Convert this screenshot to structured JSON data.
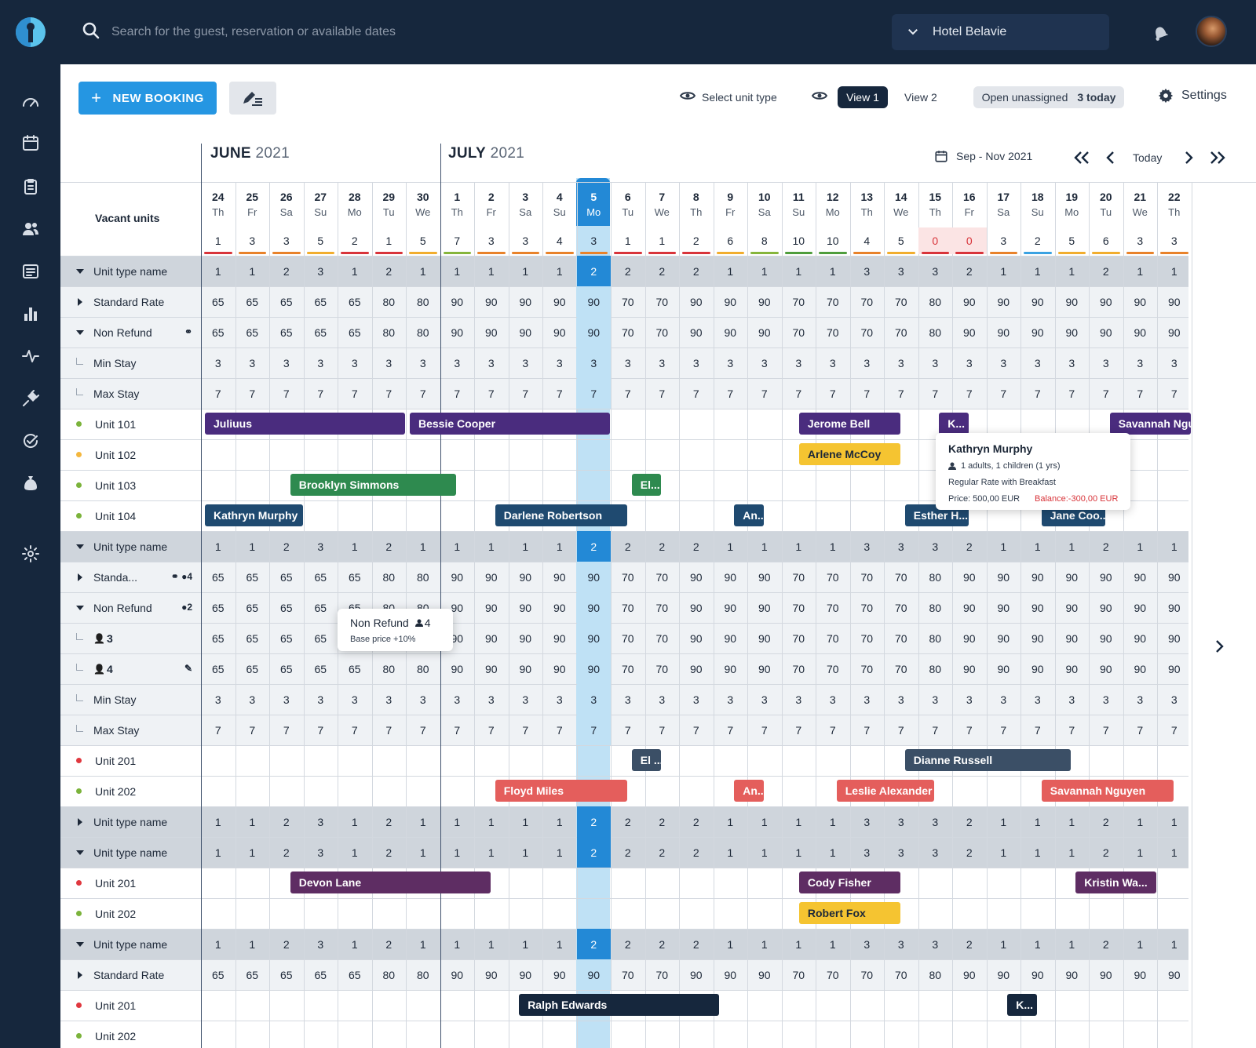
{
  "search": {
    "placeholder": "Search for the guest, reservation or available dates"
  },
  "hotel": "Hotel Belavie",
  "toolbar": {
    "new_booking": "NEW BOOKING",
    "select_unit_type": "Select unit type",
    "view1": "View 1",
    "view2": "View 2",
    "open_unassigned": "Open unassigned",
    "today_count": "3 today",
    "settings": "Settings"
  },
  "months": {
    "june_b": "JUNE",
    "june_y": "2021",
    "july_b": "JULY",
    "july_y": "2021"
  },
  "range": "Sep - Nov 2021",
  "today": "Today",
  "vacant_units": "Vacant units",
  "days": [
    [
      "24",
      "Th"
    ],
    [
      "25",
      "Fr"
    ],
    [
      "26",
      "Sa"
    ],
    [
      "27",
      "Su"
    ],
    [
      "28",
      "Mo"
    ],
    [
      "29",
      "Tu"
    ],
    [
      "30",
      "We"
    ],
    [
      "1",
      "Th"
    ],
    [
      "2",
      "Fr"
    ],
    [
      "3",
      "Sa"
    ],
    [
      "4",
      "Su"
    ],
    [
      "5",
      "Mo"
    ],
    [
      "6",
      "Tu"
    ],
    [
      "7",
      "We"
    ],
    [
      "8",
      "Th"
    ],
    [
      "9",
      "Fr"
    ],
    [
      "10",
      "Sa"
    ],
    [
      "11",
      "Su"
    ],
    [
      "12",
      "Mo"
    ],
    [
      "13",
      "Th"
    ],
    [
      "14",
      "We"
    ],
    [
      "15",
      "Th"
    ],
    [
      "16",
      "Fr"
    ],
    [
      "17",
      "Sa"
    ],
    [
      "18",
      "Su"
    ],
    [
      "19",
      "Mo"
    ],
    [
      "20",
      "Tu"
    ],
    [
      "21",
      "We"
    ],
    [
      "22",
      "Th"
    ]
  ],
  "vacant": [
    1,
    3,
    3,
    5,
    2,
    1,
    5,
    7,
    3,
    3,
    4,
    3,
    1,
    1,
    2,
    6,
    8,
    10,
    10,
    4,
    5,
    0,
    0,
    3,
    2,
    5,
    6,
    3,
    3
  ],
  "vacant_colors": [
    "#d8343a",
    "#e8822a",
    "#e8822a",
    "#f1ad2e",
    "#d8343a",
    "#d8343a",
    "#f1ad2e",
    "#86b53b",
    "#e8822a",
    "#e8822a",
    "#e8822a",
    "#e8822a",
    "#d8343a",
    "#d8343a",
    "#d8343a",
    "#f1ad2e",
    "#86b53b",
    "#4e9d3c",
    "#4e9d3c",
    "#e8822a",
    "#f1ad2e",
    "#d8343a",
    "#d8343a",
    "#e8822a",
    "#3aa2e2",
    "#f1ad2e",
    "#f1ad2e",
    "#e8822a",
    "#e8822a"
  ],
  "rows": [
    {
      "type": "grey",
      "label": "Unit type name",
      "ctl": "down",
      "vals": [
        1,
        1,
        2,
        3,
        1,
        2,
        1,
        1,
        1,
        1,
        1,
        2,
        2,
        2,
        2,
        1,
        1,
        1,
        1,
        3,
        3,
        3,
        2,
        1,
        1,
        1,
        2,
        1,
        1
      ]
    },
    {
      "type": "light",
      "label": "Standard Rate",
      "ctl": "right",
      "vals": [
        65,
        65,
        65,
        65,
        65,
        80,
        80,
        90,
        90,
        90,
        90,
        90,
        70,
        70,
        90,
        90,
        90,
        70,
        70,
        70,
        70,
        80,
        90,
        90,
        90,
        90,
        90,
        90,
        90
      ]
    },
    {
      "type": "light",
      "label": "Non Refund",
      "ctl": "down",
      "icons": "link",
      "vals": [
        65,
        65,
        65,
        65,
        65,
        80,
        80,
        90,
        90,
        90,
        90,
        90,
        70,
        70,
        90,
        90,
        90,
        70,
        70,
        70,
        70,
        80,
        90,
        90,
        90,
        90,
        90,
        90,
        90
      ]
    },
    {
      "type": "light",
      "label": "Min Stay",
      "ctl": "elbow",
      "vals": [
        3,
        3,
        3,
        3,
        3,
        3,
        3,
        3,
        3,
        3,
        3,
        3,
        3,
        3,
        3,
        3,
        3,
        3,
        3,
        3,
        3,
        3,
        3,
        3,
        3,
        3,
        3,
        3,
        3
      ]
    },
    {
      "type": "light",
      "label": "Max Stay",
      "ctl": "elbow",
      "vals": [
        7,
        7,
        7,
        7,
        7,
        7,
        7,
        7,
        7,
        7,
        7,
        7,
        7,
        7,
        7,
        7,
        7,
        7,
        7,
        7,
        7,
        7,
        7,
        7,
        7,
        7,
        7,
        7,
        7
      ]
    },
    {
      "type": "white",
      "label": "Unit 101",
      "ctl": "dot",
      "dot": "#7bb33b",
      "bookings": [
        {
          "name": "Juliuus",
          "s": 0,
          "e": 6,
          "color": "#4a2c7e"
        },
        {
          "name": "Bessie Cooper",
          "s": 6,
          "e": 12,
          "color": "#4a2c7e"
        },
        {
          "name": "Jerome Bell",
          "s": 17.4,
          "e": 20.5,
          "color": "#4a2c7e"
        },
        {
          "name": "K...",
          "s": 21.5,
          "e": 22.5,
          "color": "#4a2c7e"
        },
        {
          "name": "Savannah Ngu",
          "s": 26.5,
          "e": 29,
          "color": "#4a2c7e"
        }
      ]
    },
    {
      "type": "white",
      "label": "Unit 102",
      "ctl": "dot",
      "dot": "#f4b73e",
      "bookings": [
        {
          "name": "Arlene McCoy",
          "s": 17.4,
          "e": 20.5,
          "color": "#f5c431",
          "dark": true
        }
      ]
    },
    {
      "type": "white",
      "label": "Unit 103",
      "ctl": "dot",
      "dot": "#7bb33b",
      "bookings": [
        {
          "name": "Brooklyn Simmons",
          "s": 2.5,
          "e": 7.5,
          "color": "#2e8a4f"
        },
        {
          "name": "El...",
          "s": 12.5,
          "e": 13.5,
          "color": "#2e8a4f"
        }
      ]
    },
    {
      "type": "white",
      "label": "Unit 104",
      "ctl": "dot",
      "dot": "#7bb33b",
      "bookings": [
        {
          "name": "Kathryn Murphy",
          "s": 0,
          "e": 3,
          "color": "#1f4a70"
        },
        {
          "name": "Darlene Robertson",
          "s": 8.5,
          "e": 12.5,
          "color": "#1f4a70"
        },
        {
          "name": "An...",
          "s": 15.5,
          "e": 16.5,
          "color": "#1f4a70"
        },
        {
          "name": "Esther H...",
          "s": 20.5,
          "e": 22.5,
          "color": "#1f4a70"
        },
        {
          "name": "Jane Coo...",
          "s": 24.5,
          "e": 26.5,
          "color": "#1f4a70"
        }
      ]
    },
    {
      "type": "grey",
      "label": "Unit type name",
      "ctl": "down",
      "vals": [
        1,
        1,
        2,
        3,
        1,
        2,
        1,
        1,
        1,
        1,
        1,
        2,
        2,
        2,
        2,
        1,
        1,
        1,
        1,
        3,
        3,
        3,
        2,
        1,
        1,
        1,
        2,
        1,
        1
      ]
    },
    {
      "type": "light",
      "label": "Standa...",
      "ctl": "right",
      "icons": "link-person4",
      "vals": [
        65,
        65,
        65,
        65,
        65,
        80,
        80,
        90,
        90,
        90,
        90,
        90,
        70,
        70,
        90,
        90,
        90,
        70,
        70,
        70,
        70,
        80,
        90,
        90,
        90,
        90,
        90,
        90,
        90
      ]
    },
    {
      "type": "light",
      "label": "Non Refund",
      "ctl": "down",
      "icons": "person2",
      "vals": [
        65,
        65,
        65,
        65,
        65,
        80,
        80,
        90,
        90,
        90,
        90,
        90,
        70,
        70,
        90,
        90,
        90,
        70,
        70,
        70,
        70,
        80,
        90,
        90,
        90,
        90,
        90,
        90,
        90
      ]
    },
    {
      "type": "light",
      "label": "3",
      "ctl": "elbow-person",
      "vals": [
        65,
        65,
        65,
        65,
        65,
        80,
        80,
        90,
        90,
        90,
        90,
        90,
        70,
        70,
        90,
        90,
        90,
        70,
        70,
        70,
        70,
        80,
        90,
        90,
        90,
        90,
        90,
        90,
        90
      ]
    },
    {
      "type": "light",
      "label": "4",
      "ctl": "elbow-person",
      "icons": "pencil",
      "vals": [
        65,
        65,
        65,
        65,
        65,
        80,
        80,
        90,
        90,
        90,
        90,
        90,
        70,
        70,
        90,
        90,
        90,
        70,
        70,
        70,
        70,
        80,
        90,
        90,
        90,
        90,
        90,
        90,
        90
      ]
    },
    {
      "type": "light",
      "label": "Min Stay",
      "ctl": "elbow",
      "vals": [
        3,
        3,
        3,
        3,
        3,
        3,
        3,
        3,
        3,
        3,
        3,
        3,
        3,
        3,
        3,
        3,
        3,
        3,
        3,
        3,
        3,
        3,
        3,
        3,
        3,
        3,
        3,
        3,
        3
      ]
    },
    {
      "type": "light",
      "label": "Max Stay",
      "ctl": "elbow",
      "vals": [
        7,
        7,
        7,
        7,
        7,
        7,
        7,
        7,
        7,
        7,
        7,
        7,
        7,
        7,
        7,
        7,
        7,
        7,
        7,
        7,
        7,
        7,
        7,
        7,
        7,
        7,
        7,
        7,
        7
      ]
    },
    {
      "type": "white",
      "label": "Unit 201",
      "ctl": "dot",
      "dot": "#e0383f",
      "bookings": [
        {
          "name": "El ...",
          "s": 12.5,
          "e": 13.5,
          "color": "#3b4f66"
        },
        {
          "name": "Dianne Russell",
          "s": 20.5,
          "e": 25.5,
          "color": "#3b4f66"
        }
      ]
    },
    {
      "type": "white",
      "label": "Unit 202",
      "ctl": "dot",
      "dot": "#7bb33b",
      "bookings": [
        {
          "name": "Floyd Miles",
          "s": 8.5,
          "e": 12.5,
          "color": "#e45e5c"
        },
        {
          "name": "An...",
          "s": 15.5,
          "e": 16.5,
          "color": "#e45e5c"
        },
        {
          "name": "Leslie Alexander",
          "s": 18.5,
          "e": 21.5,
          "color": "#e45e5c"
        },
        {
          "name": "Savannah Nguyen",
          "s": 24.5,
          "e": 28.5,
          "color": "#e45e5c"
        }
      ]
    },
    {
      "type": "grey",
      "label": "Unit type name",
      "ctl": "right",
      "vals": [
        1,
        1,
        2,
        3,
        1,
        2,
        1,
        1,
        1,
        1,
        1,
        2,
        2,
        2,
        2,
        1,
        1,
        1,
        1,
        3,
        3,
        3,
        2,
        1,
        1,
        1,
        2,
        1,
        1
      ]
    },
    {
      "type": "grey",
      "label": "Unit type name",
      "ctl": "down",
      "vals": [
        1,
        1,
        2,
        3,
        1,
        2,
        1,
        1,
        1,
        1,
        1,
        2,
        2,
        2,
        2,
        1,
        1,
        1,
        1,
        3,
        3,
        3,
        2,
        1,
        1,
        1,
        2,
        1,
        1
      ]
    },
    {
      "type": "white",
      "label": "Unit 201",
      "ctl": "dot",
      "dot": "#e0383f",
      "bookings": [
        {
          "name": "Devon Lane",
          "s": 2.5,
          "e": 8.5,
          "color": "#5e2d63"
        },
        {
          "name": "Cody Fisher",
          "s": 17.4,
          "e": 20.5,
          "color": "#5e2d63"
        },
        {
          "name": "Kristin Wa...",
          "s": 25.5,
          "e": 28,
          "color": "#5e2d63"
        }
      ]
    },
    {
      "type": "white",
      "label": "Unit 202",
      "ctl": "dot",
      "dot": "#7bb33b",
      "bookings": [
        {
          "name": "Robert Fox",
          "s": 17.4,
          "e": 20.5,
          "color": "#f5c431",
          "dark": true
        }
      ]
    },
    {
      "type": "grey",
      "label": "Unit type name",
      "ctl": "down",
      "vals": [
        1,
        1,
        2,
        3,
        1,
        2,
        1,
        1,
        1,
        1,
        1,
        2,
        2,
        2,
        2,
        1,
        1,
        1,
        1,
        3,
        3,
        3,
        2,
        1,
        1,
        1,
        2,
        1,
        1
      ]
    },
    {
      "type": "light",
      "label": "Standard Rate",
      "ctl": "right",
      "vals": [
        65,
        65,
        65,
        65,
        65,
        80,
        80,
        90,
        90,
        90,
        90,
        90,
        70,
        70,
        90,
        90,
        90,
        70,
        70,
        70,
        70,
        80,
        90,
        90,
        90,
        90,
        90,
        90,
        90
      ]
    },
    {
      "type": "white",
      "label": "Unit 201",
      "ctl": "dot",
      "dot": "#e0383f",
      "bookings": [
        {
          "name": "Ralph Edwards",
          "s": 9.2,
          "e": 15.2,
          "color": "#16273d"
        },
        {
          "name": "K...",
          "s": 23.5,
          "e": 24.5,
          "color": "#16273d"
        }
      ]
    },
    {
      "type": "white",
      "label": "Unit 202",
      "ctl": "dot",
      "dot": "#7bb33b",
      "bookings": []
    }
  ],
  "tooltip_booking": {
    "name": "Kathryn Murphy",
    "guests": "1 adults, 1 children (1 yrs)",
    "rate": "Regular Rate with Breakfast",
    "price": "Price: 500,00 EUR",
    "balance": "Balance:-300,00 EUR"
  },
  "tooltip_rate": {
    "title": "Non Refund",
    "persons": "4",
    "note": "Base price +10%"
  },
  "colors": {
    "sidebar": "#16273d",
    "primary": "#2596e2",
    "today": "#2389d6",
    "balance": "#d8343a"
  }
}
